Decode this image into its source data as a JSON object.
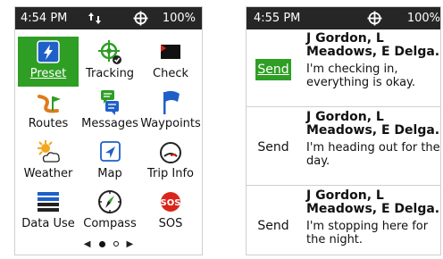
{
  "left_screen": {
    "status": {
      "time": "4:54 PM",
      "battery": "100%"
    },
    "tiles": [
      {
        "label": "Preset",
        "icon": "preset-icon",
        "selected": true
      },
      {
        "label": "Tracking",
        "icon": "tracking-icon"
      },
      {
        "label": "Check",
        "icon": "check-icon"
      },
      {
        "label": "Routes",
        "icon": "routes-icon"
      },
      {
        "label": "Messages",
        "icon": "messages-icon"
      },
      {
        "label": "Waypoints",
        "icon": "waypoints-icon"
      },
      {
        "label": "Weather",
        "icon": "weather-icon"
      },
      {
        "label": "Map",
        "icon": "map-icon"
      },
      {
        "label": "Trip Info",
        "icon": "trip-info-icon"
      },
      {
        "label": "Data Use",
        "icon": "data-use-icon"
      },
      {
        "label": "Compass",
        "icon": "compass-icon"
      },
      {
        "label": "SOS",
        "icon": "sos-icon"
      }
    ],
    "sos_badge": "SOS",
    "pager": {
      "pages": 2,
      "current": 1
    }
  },
  "right_screen": {
    "status": {
      "time": "4:55 PM",
      "battery": "100%"
    },
    "messages": [
      {
        "send_label": "Send",
        "from_line1": "J Gordon, L",
        "from_line2": "Meadows, E Delga...",
        "body": [
          "I'm checking in,",
          "everything is okay."
        ],
        "active": true
      },
      {
        "send_label": "Send",
        "from_line1": "J Gordon, L",
        "from_line2": "Meadows, E Delga...",
        "body": [
          "I'm heading out for the",
          "day."
        ],
        "active": false
      },
      {
        "send_label": "Send",
        "from_line1": "J Gordon, L",
        "from_line2": "Meadows, E Delga...",
        "body": [
          "I'm stopping here for",
          "the night."
        ],
        "active": false
      }
    ]
  },
  "colors": {
    "accent_green": "#2f9e24",
    "statusbar": "#262626",
    "blue": "#1f5fc8",
    "sos_red": "#d9261c"
  }
}
